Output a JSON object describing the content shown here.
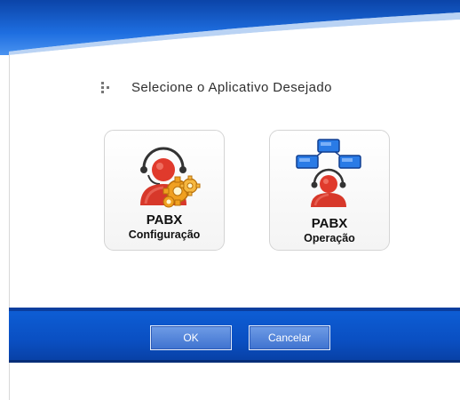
{
  "dialog": {
    "title": "Selecione o Aplicativo Desejado",
    "apps": [
      {
        "name_line1": "PABX",
        "name_line2": "Configuração",
        "icon": "user-headset-gears-icon"
      },
      {
        "name_line1": "PABX",
        "name_line2": "Operação",
        "icon": "user-headset-network-icon"
      }
    ],
    "buttons": {
      "ok": "OK",
      "cancel": "Cancelar"
    }
  },
  "colors": {
    "footer_blue": "#0a4fc2",
    "header_blue": "#1a5fd0",
    "person_red": "#d7382a",
    "gear_orange": "#f0a020",
    "screen_blue": "#2a7be6"
  }
}
